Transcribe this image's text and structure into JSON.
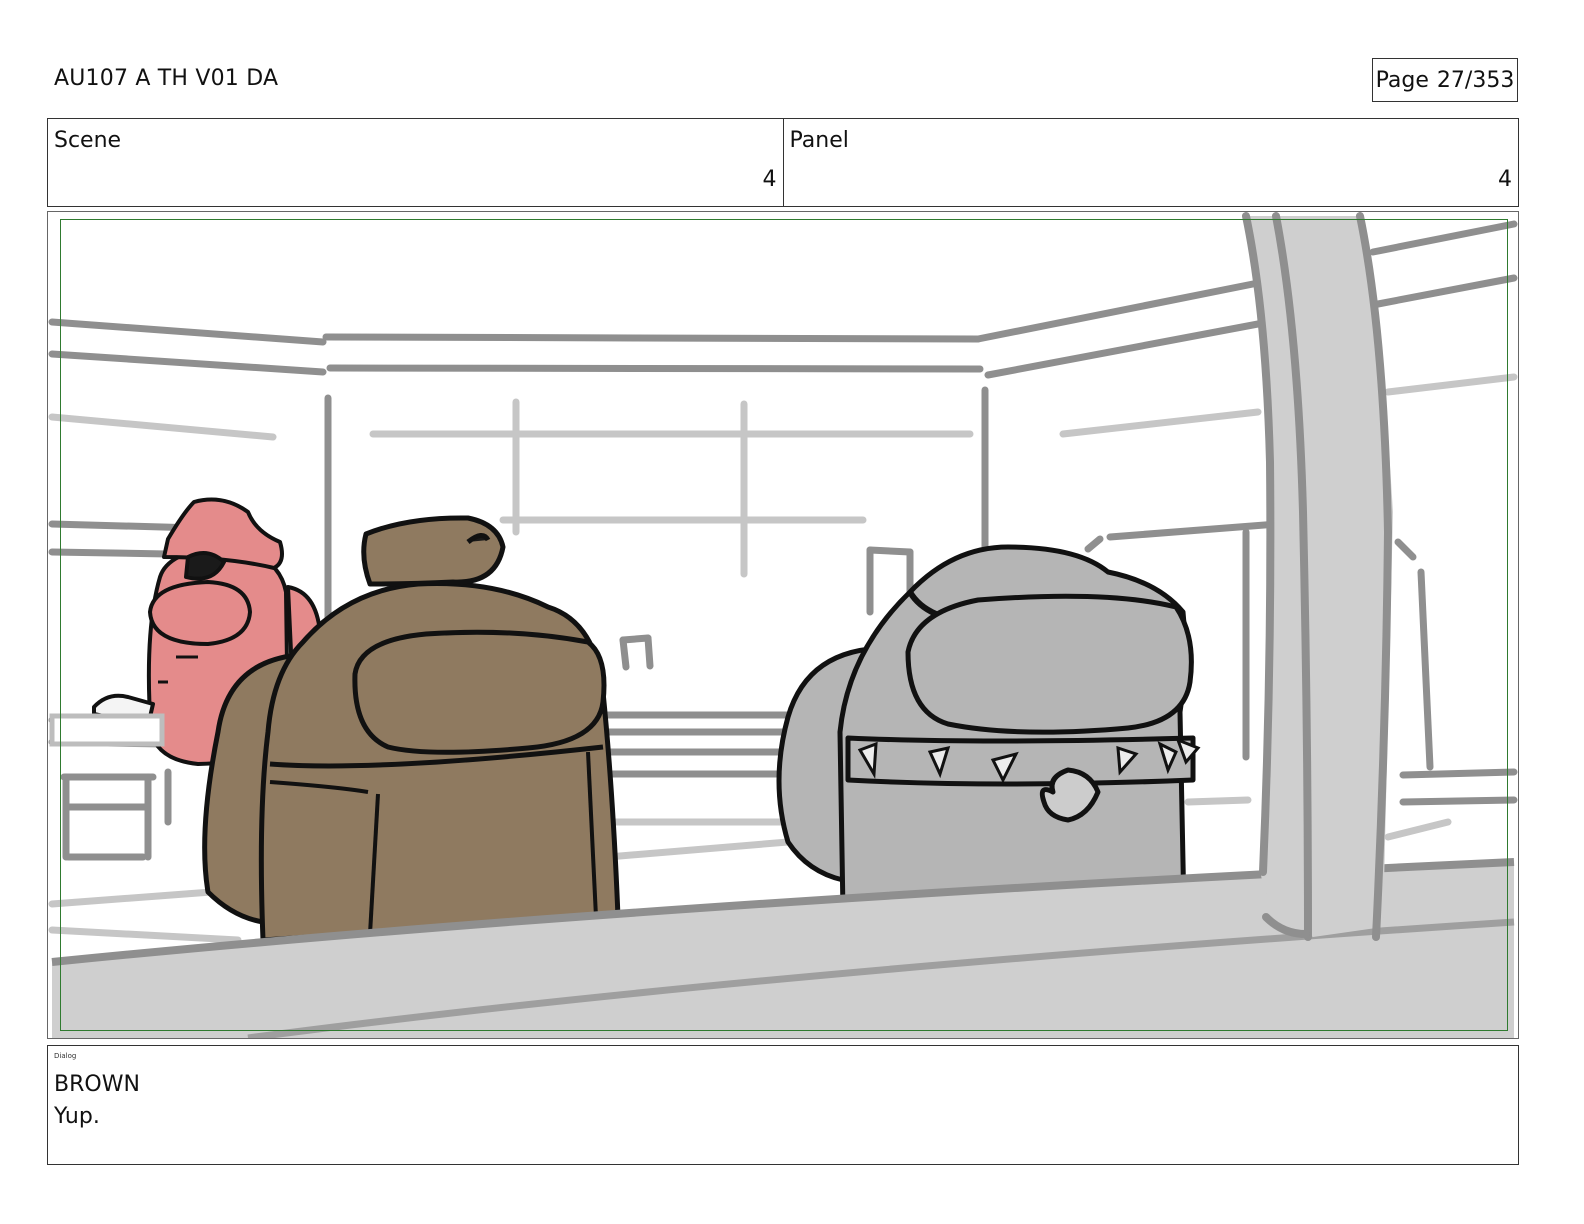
{
  "header": {
    "title": "AU107 A TH V01 DA",
    "page_label": "Page",
    "page_number": "27/353"
  },
  "info": {
    "scene_label": "Scene",
    "scene_value": "4",
    "panel_label": "Panel",
    "panel_value": "4"
  },
  "panel": {
    "frame_color": "#2f7a2f",
    "character_colors": {
      "pink": "#e48b8b",
      "brown": "#8f7a60",
      "grey": "#b5b5b5"
    }
  },
  "dialog": {
    "tag": "Dialog",
    "speaker": "BROWN",
    "line": "Yup."
  }
}
